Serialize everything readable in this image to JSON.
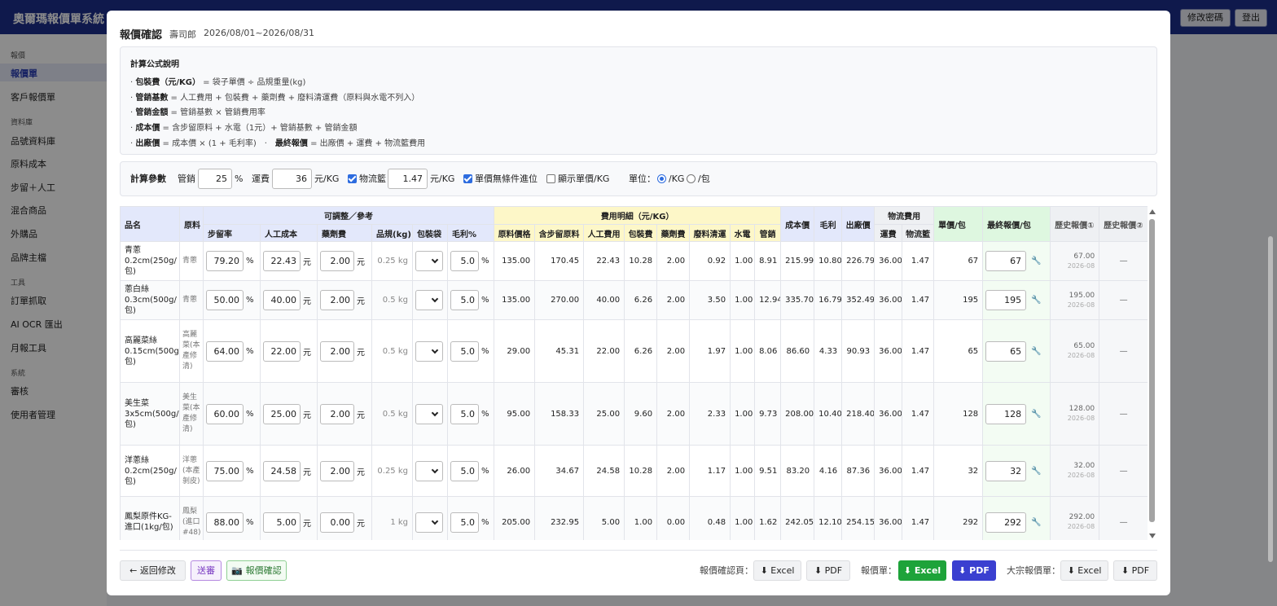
{
  "app": {
    "title": "奧爾瑪報價單系統",
    "top_buttons": [
      "修改密碼",
      "登出"
    ]
  },
  "sidebar": {
    "sections": [
      {
        "label": "報價",
        "items": [
          "報價單",
          "客戶報價單"
        ]
      },
      {
        "label": "資料庫",
        "items": [
          "品號資料庫",
          "原料成本",
          "步留＋人工",
          "混合商品",
          "外購品",
          "品牌主檔"
        ]
      },
      {
        "label": "工具",
        "items": [
          "訂單抓取",
          "AI OCR 匯出",
          "月報工具"
        ]
      },
      {
        "label": "系統",
        "items": [
          "審核",
          "使用者管理"
        ]
      }
    ],
    "active_item": "報價單"
  },
  "modal": {
    "title": "報價確認",
    "customer": "壽司郎",
    "period": "2026/08/01~2026/08/31",
    "formula": {
      "title": "計算公式說明",
      "lines": [
        {
          "key": "包裝費（元/KG）",
          "text": " = 袋子單價 ÷ 品規重量(kg)"
        },
        {
          "key": "管銷基數",
          "text": " = 人工費用 + 包裝費 + 藥劑費 + 廢料清運費（原料與水電不列入）"
        },
        {
          "key": "管銷金額",
          "text": " = 管銷基數 × 管銷費用率"
        },
        {
          "key": "成本價",
          "text": " = 含步留原料 + 水電（1元）+ 管銷基數 + 管銷金額"
        },
        {
          "key": "出廠價",
          "text": " = 成本價 × (1 + 毛利率)",
          "key2": "最終報價",
          "text2": " = 出廠價 + 運費 + 物流籃費用"
        }
      ]
    },
    "params": {
      "label": "計算參數",
      "mgmt_label": "管銷",
      "mgmt_value": "25",
      "mgmt_unit": "%",
      "freight_label": "運費",
      "freight_value": "36",
      "freight_unit": "元/KG",
      "basket_label": "物流籃",
      "basket_checked": true,
      "basket_value": "1.47",
      "basket_unit": "元/KG",
      "round_label": "單價無條件進位",
      "round_checked": true,
      "show_unit_label": "顯示單價/KG",
      "show_unit_checked": false,
      "unit_label": "單位：",
      "unit_options": [
        "/KG",
        "/包"
      ],
      "unit_selected": "/KG"
    },
    "table": {
      "groups": {
        "adjustable": "可調整／參考",
        "cost_detail": "費用明細（元/KG）",
        "logistics": "物流費用"
      },
      "headers": {
        "name": "品名",
        "material": "原料",
        "yield": "步留率",
        "labor": "人工成本",
        "chem": "藥劑費",
        "spec": "品規(kg)",
        "bag": "包裝袋",
        "margin": "毛利%",
        "raw_price": "原料價格",
        "raw_with_yield": "含步留原料",
        "labor_fee": "人工費用",
        "pack_fee": "包裝費",
        "chem_fee": "藥劑費",
        "waste_fee": "廢料清運",
        "utility": "水電",
        "mgmt": "管銷",
        "cost_price": "成本價",
        "profit": "毛利",
        "factory_price": "出廠價",
        "freight": "運費",
        "basket": "物流籃",
        "unit_price": "單價/包",
        "final_price": "最終報價/包",
        "hist1": "歷史報價①",
        "hist2": "歷史報價②"
      },
      "units": {
        "pct": "%",
        "yuan": "元"
      },
      "rows": [
        {
          "name": "青蔥\n0.2cm(250g/包)",
          "material": "青蔥",
          "yield": "79.20",
          "labor": "22.43",
          "chem": "2.00",
          "spec": "0.25 kg",
          "margin": "5.0",
          "raw_price": "135.00",
          "raw_with_yield": "170.45",
          "labor_fee": "22.43",
          "pack_fee": "10.28",
          "chem_fee": "2.00",
          "waste_fee": "0.92",
          "utility": "1.00",
          "mgmt": "8.91",
          "cost_price": "215.99",
          "profit": "10.80",
          "factory_price": "226.79",
          "freight": "36.00",
          "basket": "1.47",
          "unit_price": "67",
          "final_price": "67",
          "hist1_value": "67.00",
          "hist1_date": "2026-08",
          "hist2": "—"
        },
        {
          "name": "蔥白絲\n0.3cm(500g/包)",
          "material": "青蔥",
          "yield": "50.00",
          "labor": "40.00",
          "chem": "2.00",
          "spec": "0.5 kg",
          "margin": "5.0",
          "raw_price": "135.00",
          "raw_with_yield": "270.00",
          "labor_fee": "40.00",
          "pack_fee": "6.26",
          "chem_fee": "2.00",
          "waste_fee": "3.50",
          "utility": "1.00",
          "mgmt": "12.94",
          "cost_price": "335.70",
          "profit": "16.79",
          "factory_price": "352.49",
          "freight": "36.00",
          "basket": "1.47",
          "unit_price": "195",
          "final_price": "195",
          "hist1_value": "195.00",
          "hist1_date": "2026-08",
          "hist2": "—"
        },
        {
          "name": "高麗菜絲\n0.15cm(500g/包)",
          "material": "高麗菜(本產修清)",
          "yield": "64.00",
          "labor": "22.00",
          "chem": "2.00",
          "spec": "0.5 kg",
          "margin": "5.0",
          "raw_price": "29.00",
          "raw_with_yield": "45.31",
          "labor_fee": "22.00",
          "pack_fee": "6.26",
          "chem_fee": "2.00",
          "waste_fee": "1.97",
          "utility": "1.00",
          "mgmt": "8.06",
          "cost_price": "86.60",
          "profit": "4.33",
          "factory_price": "90.93",
          "freight": "36.00",
          "basket": "1.47",
          "unit_price": "65",
          "final_price": "65",
          "hist1_value": "65.00",
          "hist1_date": "2026-08",
          "hist2": "—"
        },
        {
          "name": "美生菜\n3x5cm(500g/包)",
          "material": "美生菜(本產修清)",
          "yield": "60.00",
          "labor": "25.00",
          "chem": "2.00",
          "spec": "0.5 kg",
          "margin": "5.0",
          "raw_price": "95.00",
          "raw_with_yield": "158.33",
          "labor_fee": "25.00",
          "pack_fee": "9.60",
          "chem_fee": "2.00",
          "waste_fee": "2.33",
          "utility": "1.00",
          "mgmt": "9.73",
          "cost_price": "208.00",
          "profit": "10.40",
          "factory_price": "218.40",
          "freight": "36.00",
          "basket": "1.47",
          "unit_price": "128",
          "final_price": "128",
          "hist1_value": "128.00",
          "hist1_date": "2026-08",
          "hist2": "—"
        },
        {
          "name": "洋蔥絲\n0.2cm(250g/包)",
          "material": "洋蔥(本產剝皮)",
          "yield": "75.00",
          "labor": "24.58",
          "chem": "2.00",
          "spec": "0.25 kg",
          "margin": "5.0",
          "raw_price": "26.00",
          "raw_with_yield": "34.67",
          "labor_fee": "24.58",
          "pack_fee": "10.28",
          "chem_fee": "2.00",
          "waste_fee": "1.17",
          "utility": "1.00",
          "mgmt": "9.51",
          "cost_price": "83.20",
          "profit": "4.16",
          "factory_price": "87.36",
          "freight": "36.00",
          "basket": "1.47",
          "unit_price": "32",
          "final_price": "32",
          "hist1_value": "32.00",
          "hist1_date": "2026-08",
          "hist2": "—"
        },
        {
          "name": "鳳梨原件KG-進口(1kg/包)",
          "material": "鳳梨(進口#48)",
          "yield": "88.00",
          "labor": "5.00",
          "chem": "0.00",
          "spec": "1 kg",
          "margin": "5.0",
          "raw_price": "205.00",
          "raw_with_yield": "232.95",
          "labor_fee": "5.00",
          "pack_fee": "1.00",
          "chem_fee": "0.00",
          "waste_fee": "0.48",
          "utility": "1.00",
          "mgmt": "1.62",
          "cost_price": "242.05",
          "profit": "12.10",
          "factory_price": "254.15",
          "freight": "36.00",
          "basket": "1.47",
          "unit_price": "292",
          "final_price": "292",
          "hist1_value": "292.00",
          "hist1_date": "2026-08",
          "hist2": "—"
        }
      ]
    },
    "footer": {
      "back": "← 返回修改",
      "submit": "送審",
      "confirm": "📷 報價確認",
      "confirm_page_label": "報價確認頁：",
      "quote_label": "報價單：",
      "bulk_label": "大宗報價單：",
      "excel": "⬇ Excel",
      "pdf": "⬇ PDF"
    }
  }
}
